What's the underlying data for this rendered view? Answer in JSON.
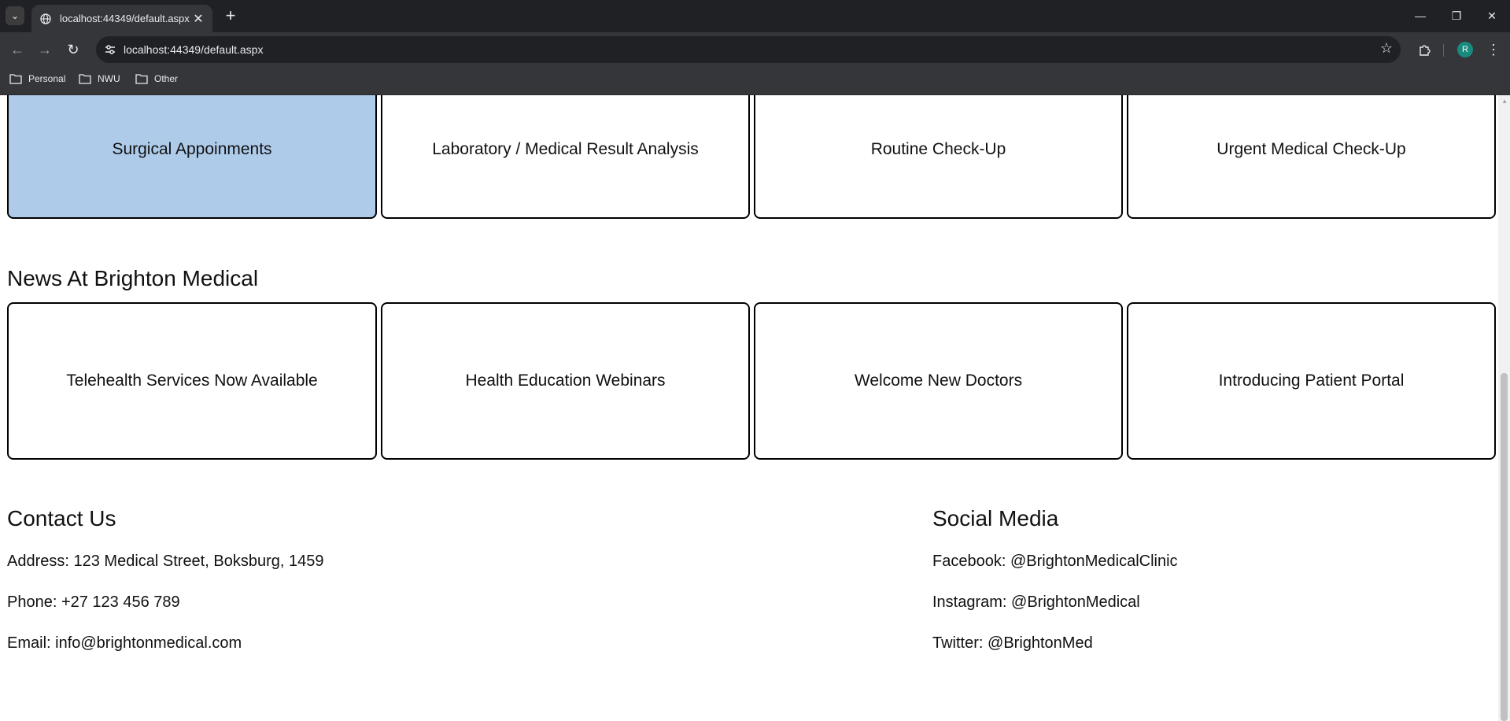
{
  "browser": {
    "tab_title": "localhost:44349/default.aspx",
    "url": "localhost:44349/default.aspx",
    "profile_initial": "R",
    "bookmarks": [
      "Personal",
      "NWU",
      "Other"
    ]
  },
  "services": {
    "items": [
      {
        "label": "Surgical Appoinments",
        "selected": true
      },
      {
        "label": "Laboratory / Medical Result Analysis",
        "selected": false
      },
      {
        "label": "Routine Check-Up",
        "selected": false
      },
      {
        "label": "Urgent Medical Check-Up",
        "selected": false
      }
    ]
  },
  "news": {
    "heading": "News At Brighton Medical",
    "items": [
      "Telehealth Services Now Available",
      "Health Education Webinars",
      "Welcome New Doctors",
      "Introducing Patient Portal"
    ]
  },
  "contact": {
    "heading": "Contact Us",
    "address": "Address: 123 Medical Street, Boksburg, 1459",
    "phone": "Phone: +27 123 456 789",
    "email": "Email: info@brightonmedical.com"
  },
  "social": {
    "heading": "Social Media",
    "facebook": "Facebook: @BrightonMedicalClinic",
    "instagram": "Instagram: @BrightonMedical",
    "twitter": "Twitter: @BrightonMed"
  },
  "colors": {
    "selected_card": "#aecbea",
    "chrome_dark": "#202124",
    "chrome_toolbar": "#35363a"
  }
}
